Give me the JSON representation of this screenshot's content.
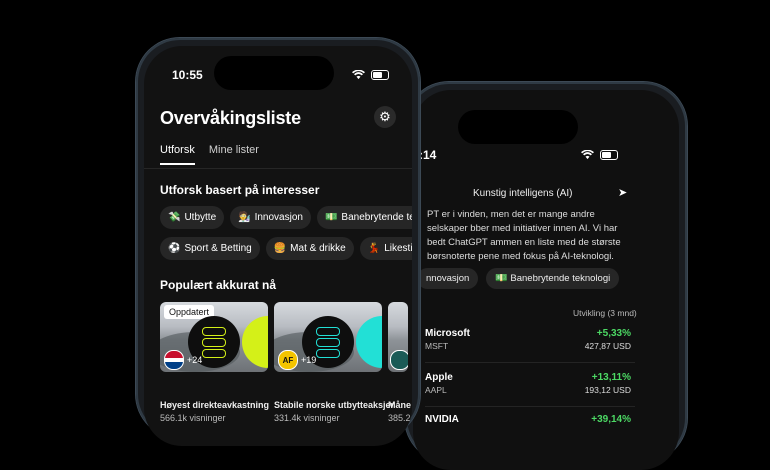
{
  "back": {
    "status_time": ":14",
    "title": "Kunstig intelligens (AI)",
    "description": "PT er i vinden, men det er mange andre selskaper bber med initiativer innen AI. Vi har bedt ChatGPT ammen en liste med de største børsnoterte pene med fokus på AI-teknologi.",
    "chips": [
      {
        "emoji": "",
        "label": "nnovasjon"
      },
      {
        "emoji": "💵",
        "label": "Banebrytende teknologi"
      }
    ],
    "column_label": "Utvikling (3 mnd)",
    "stocks": [
      {
        "name": "Microsoft",
        "ticker": "MSFT",
        "change": "+5,33%",
        "price": "427,87 USD"
      },
      {
        "name": "Apple",
        "ticker": "AAPL",
        "change": "+13,11%",
        "price": "193,12 USD"
      },
      {
        "name": "NVIDIA",
        "ticker": "",
        "change": "+39,14%",
        "price": ""
      }
    ]
  },
  "front": {
    "status_time": "10:55",
    "title": "Overvåkingsliste",
    "tabs": [
      "Utforsk",
      "Mine lister"
    ],
    "interests_heading": "Utforsk basert på interesser",
    "chips_row1": [
      {
        "emoji": "💸",
        "label": "Utbytte"
      },
      {
        "emoji": "🧑‍🔬",
        "label": "Innovasjon"
      },
      {
        "emoji": "💵",
        "label": "Banebrytende te"
      }
    ],
    "chips_row2": [
      {
        "emoji": "⚽",
        "label": "Sport & Betting"
      },
      {
        "emoji": "🍔",
        "label": "Mat & drikke"
      },
      {
        "emoji": "💃",
        "label": "Likestil"
      }
    ],
    "popular_heading": "Populært akkurat nå",
    "cards": [
      {
        "badge": "Oppdatert",
        "count": "+24",
        "avatar": "",
        "name": "Høyest direkteavkastning",
        "views": "566.1k visninger"
      },
      {
        "badge": "",
        "count": "+19",
        "avatar": "AF",
        "name": "Stabile norske utbytteaksjer",
        "views": "331.4k visninger"
      },
      {
        "badge": "",
        "count": "",
        "avatar": "",
        "name": "Måne",
        "views": "385.2"
      }
    ]
  },
  "colors": {
    "lime": "#d4f018",
    "cyan": "#22e0d6",
    "positive": "#4cd964"
  }
}
